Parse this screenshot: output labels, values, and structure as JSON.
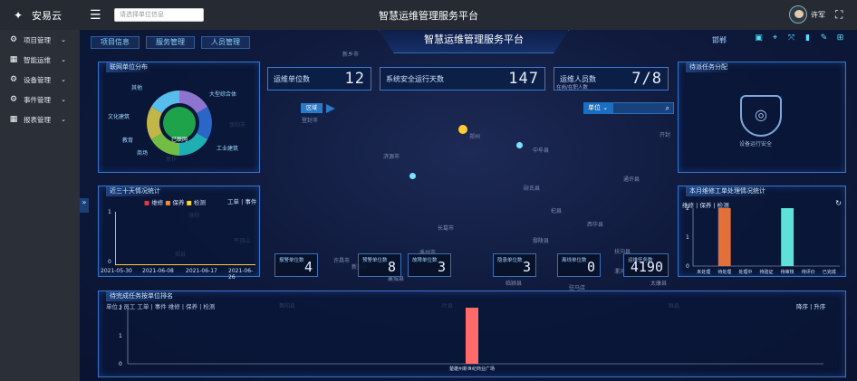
{
  "header": {
    "logo": "安易云",
    "search_placeholder": "请选择单位信息",
    "title": "智慧运维管理服务平台",
    "user": "许军"
  },
  "sidebar": [
    {
      "label": "项目管理",
      "icon": "gear-icon"
    },
    {
      "label": "智能运维",
      "icon": "chart-icon"
    },
    {
      "label": "设备管理",
      "icon": "gear-icon"
    },
    {
      "label": "事件管理",
      "icon": "gear-icon"
    },
    {
      "label": "报表管理",
      "icon": "chart-icon"
    }
  ],
  "nav": {
    "tab1": "项目信息",
    "tab2": "服务管理",
    "tab3": "人员管理",
    "center": "智慧运维管理服务平台",
    "region": "邯郸"
  },
  "stats": {
    "units_label": "运维单位数",
    "units": "12",
    "days_label": "系统安全运行天数",
    "days": "147",
    "staff_label": "运维人员数",
    "staff": "7/8",
    "staff_note": "在岗/在职人数"
  },
  "map": {
    "filter_btn": "单位",
    "region_btn": "区域",
    "labels": [
      "新乡市",
      "郑州",
      "开封",
      "洛阳",
      "新郑市",
      "漯河",
      "许昌市",
      "平顶山",
      "驻马店",
      "焦作",
      "济源市",
      "荥阳市",
      "登封市",
      "中牟县",
      "尉氏县",
      "禹州市",
      "长葛市",
      "鄢陵县",
      "襄城县",
      "郏县",
      "叶县",
      "舞阳县",
      "临颍县",
      "西华县",
      "扶沟县",
      "太康县",
      "睢县",
      "杞县",
      "通许县"
    ]
  },
  "left_top": {
    "title": "联网单位分布",
    "center": "已联网",
    "labels": [
      "其他",
      "大型综合体",
      "文化建筑",
      "教育",
      "商场",
      "工业建筑"
    ]
  },
  "left_mid": {
    "title": "近三十天情况统计",
    "legend": [
      "维修",
      "保养",
      "检测"
    ],
    "tabs": "工单 | 事件",
    "ylabel_1": "1",
    "ylabel_0": "0",
    "dates": [
      "2021-05-30",
      "2021-06-08",
      "2021-06-17",
      "2021-06-26"
    ]
  },
  "right_top": {
    "title": "待派任务分配",
    "caption": "设备运行安全"
  },
  "right_mid": {
    "title": "本月维修工单处理情况统计",
    "tabs": "维修 | 保养 | 检测",
    "y": [
      "2",
      "1",
      "0"
    ],
    "x": [
      "未处理",
      "待处理",
      "处理中",
      "待验证",
      "待审核",
      "待评价",
      "已完成"
    ]
  },
  "counters": [
    {
      "label": "报警单位数",
      "value": "4"
    },
    {
      "label": "预警单位数",
      "value": "8"
    },
    {
      "label": "故障单位数",
      "value": "3"
    },
    {
      "label": "隐患单位数",
      "value": "3"
    },
    {
      "label": "离线单位数",
      "value": "0"
    },
    {
      "label": "运维任务数",
      "value": "4190"
    }
  ],
  "bottom": {
    "title": "待完成任务按单位排名",
    "tabs": "单位 | 员工  工单 | 事件  维修 | 保养 | 检测",
    "sort": "降序 | 升序",
    "y": [
      "2",
      "1",
      "0"
    ],
    "bar_label": "楚雄州新世纪商业广场"
  },
  "chart_data": [
    {
      "type": "pie",
      "title": "联网单位分布",
      "categories": [
        "其他",
        "大型综合体",
        "文化建筑",
        "教育",
        "商场",
        "工业建筑"
      ],
      "values": [
        1,
        1,
        1,
        1,
        1,
        1
      ]
    },
    {
      "type": "bar",
      "title": "本月维修工单处理情况统计",
      "categories": [
        "未处理",
        "待处理",
        "处理中",
        "待验证",
        "待审核",
        "待评价",
        "已完成"
      ],
      "values": [
        0,
        2,
        0,
        0,
        2,
        0,
        0
      ],
      "ylim": [
        0,
        2
      ]
    },
    {
      "type": "bar",
      "title": "待完成任务按单位排名",
      "categories": [
        "楚雄州新世纪商业广场"
      ],
      "values": [
        2
      ],
      "ylim": [
        0,
        2
      ]
    }
  ]
}
